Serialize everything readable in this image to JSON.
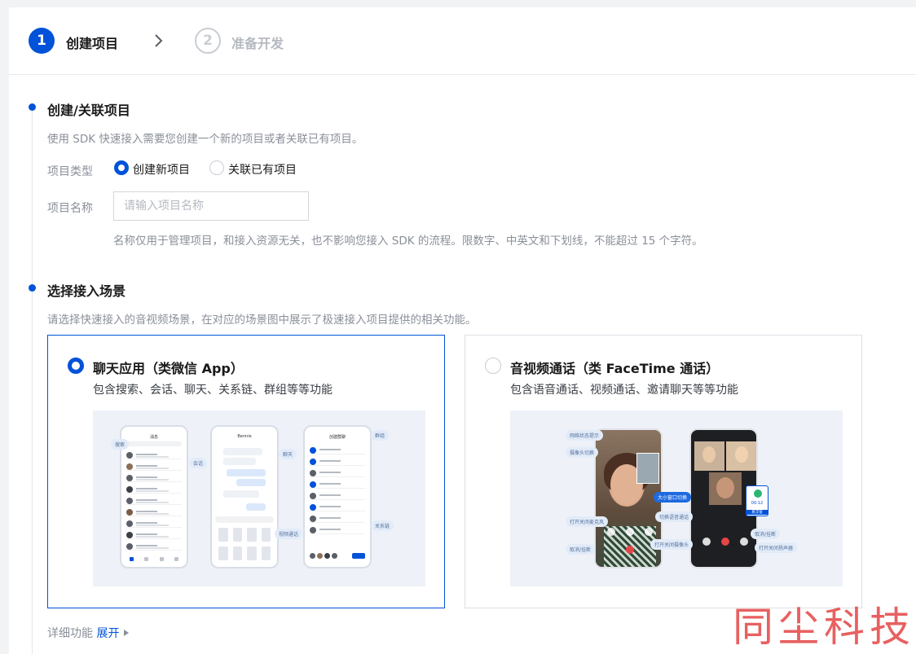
{
  "steps": [
    {
      "number": "1",
      "label": "创建项目"
    },
    {
      "number": "2",
      "label": "准备开发"
    }
  ],
  "create_section": {
    "title": "创建/关联项目",
    "desc": "使用 SDK 快速接入需要您创建一个新的项目或者关联已有项目。",
    "type_label": "项目类型",
    "type_options": [
      "创建新项目",
      "关联已有项目"
    ],
    "name_label": "项目名称",
    "name_placeholder": "请输入项目名称",
    "name_value": "",
    "hint": "名称仅用于管理项目，和接入资源无关，也不影响您接入 SDK 的流程。限数字、中英文和下划线，不能超过 15 个字符。"
  },
  "scene_section": {
    "title": "选择接入场景",
    "desc": "请选择快速接入的音视频场景，在对应的场景图中展示了极速接入项目提供的相关功能。",
    "cards": [
      {
        "title": "聊天应用（类微信 App）",
        "desc": "包含搜索、会话、聊天、关系链、群组等等功能",
        "tags": [
          "搜索",
          "会话",
          "聊天",
          "群组",
          "关系链",
          "视频通话"
        ],
        "phone_titles": [
          "消息",
          "Bennie",
          "创建群聊"
        ]
      },
      {
        "title": "音视频通话（类 FaceTime 通话）",
        "desc": "包含语音通话、视频通话、邀请聊天等等功能",
        "tags": [
          "网络状态提示",
          "摄像头切换",
          "大小窗口切换",
          "切换语音通话",
          "打开关闭麦克风",
          "打开关闭摄像头",
          "取消/挂断",
          "取消/挂断",
          "打开关闭扬声器"
        ],
        "call_timer": "00:12",
        "call_label": "悬浮窗"
      }
    ]
  },
  "details": {
    "label": "详细功能",
    "link": "展开"
  },
  "watermark": "同尘科技",
  "colors": {
    "primary": "#0052d9",
    "muted": "#8a8f99",
    "border": "#dcdfe4"
  }
}
